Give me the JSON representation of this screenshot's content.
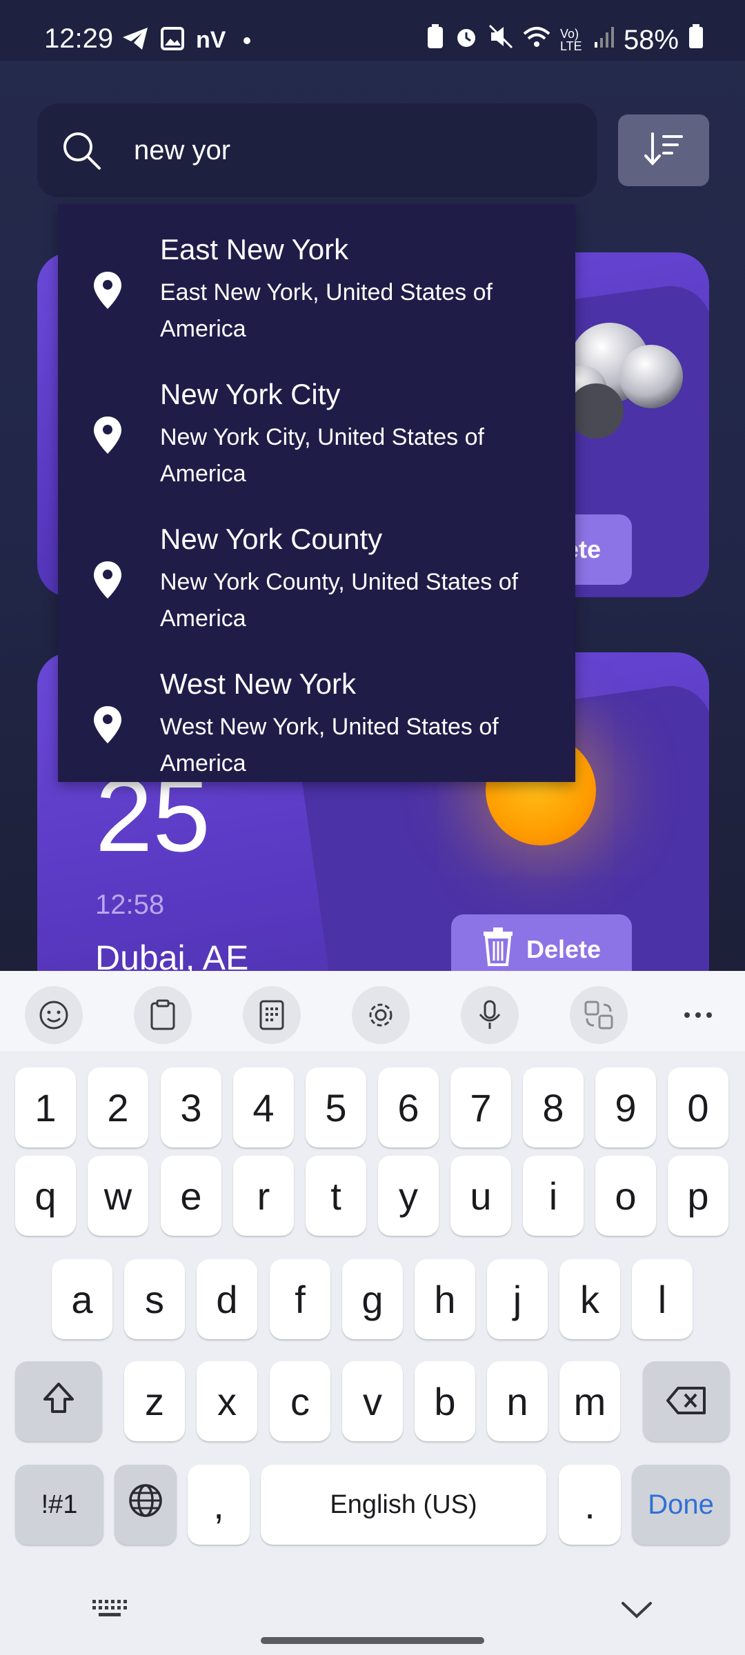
{
  "status_bar": {
    "time": "12:29",
    "battery": "58%",
    "network_label": "nV",
    "volte_label": "Vo) LTE"
  },
  "search": {
    "value": "new yor",
    "placeholder": ""
  },
  "suggestions": [
    {
      "title": "East New York",
      "subtitle": "East New York, United States of America"
    },
    {
      "title": "New York City",
      "subtitle": "New York City, United States of America"
    },
    {
      "title": "New York County",
      "subtitle": "New York County, United States of America"
    },
    {
      "title": "West New York",
      "subtitle": "West New York, United States of America"
    }
  ],
  "cards": [
    {
      "delete_label": "Delete",
      "icon": "cloud-icon"
    },
    {
      "temperature": "25",
      "time": "12:58",
      "city": "Dubai, AE",
      "delete_label": "Delete",
      "icon": "sun-icon"
    }
  ],
  "keyboard": {
    "number_row": [
      "1",
      "2",
      "3",
      "4",
      "5",
      "6",
      "7",
      "8",
      "9",
      "0"
    ],
    "row1": [
      "q",
      "w",
      "e",
      "r",
      "t",
      "y",
      "u",
      "i",
      "o",
      "p"
    ],
    "row2": [
      "a",
      "s",
      "d",
      "f",
      "g",
      "h",
      "j",
      "k",
      "l"
    ],
    "row3": [
      "z",
      "x",
      "c",
      "v",
      "b",
      "n",
      "m"
    ],
    "symbols_label": "!#1",
    "comma_label": ",",
    "space_label": "English (US)",
    "period_label": ".",
    "done_label": "Done",
    "toolbar_icons": [
      "emoji-icon",
      "clipboard-icon",
      "keypad-icon",
      "settings-icon",
      "microphone-icon",
      "translate-icon",
      "more-icon"
    ]
  },
  "colors": {
    "app_background": "#22274a",
    "card": "#5c3fc8",
    "dropdown": "#201c48",
    "done_accent": "#2f6fd6"
  }
}
